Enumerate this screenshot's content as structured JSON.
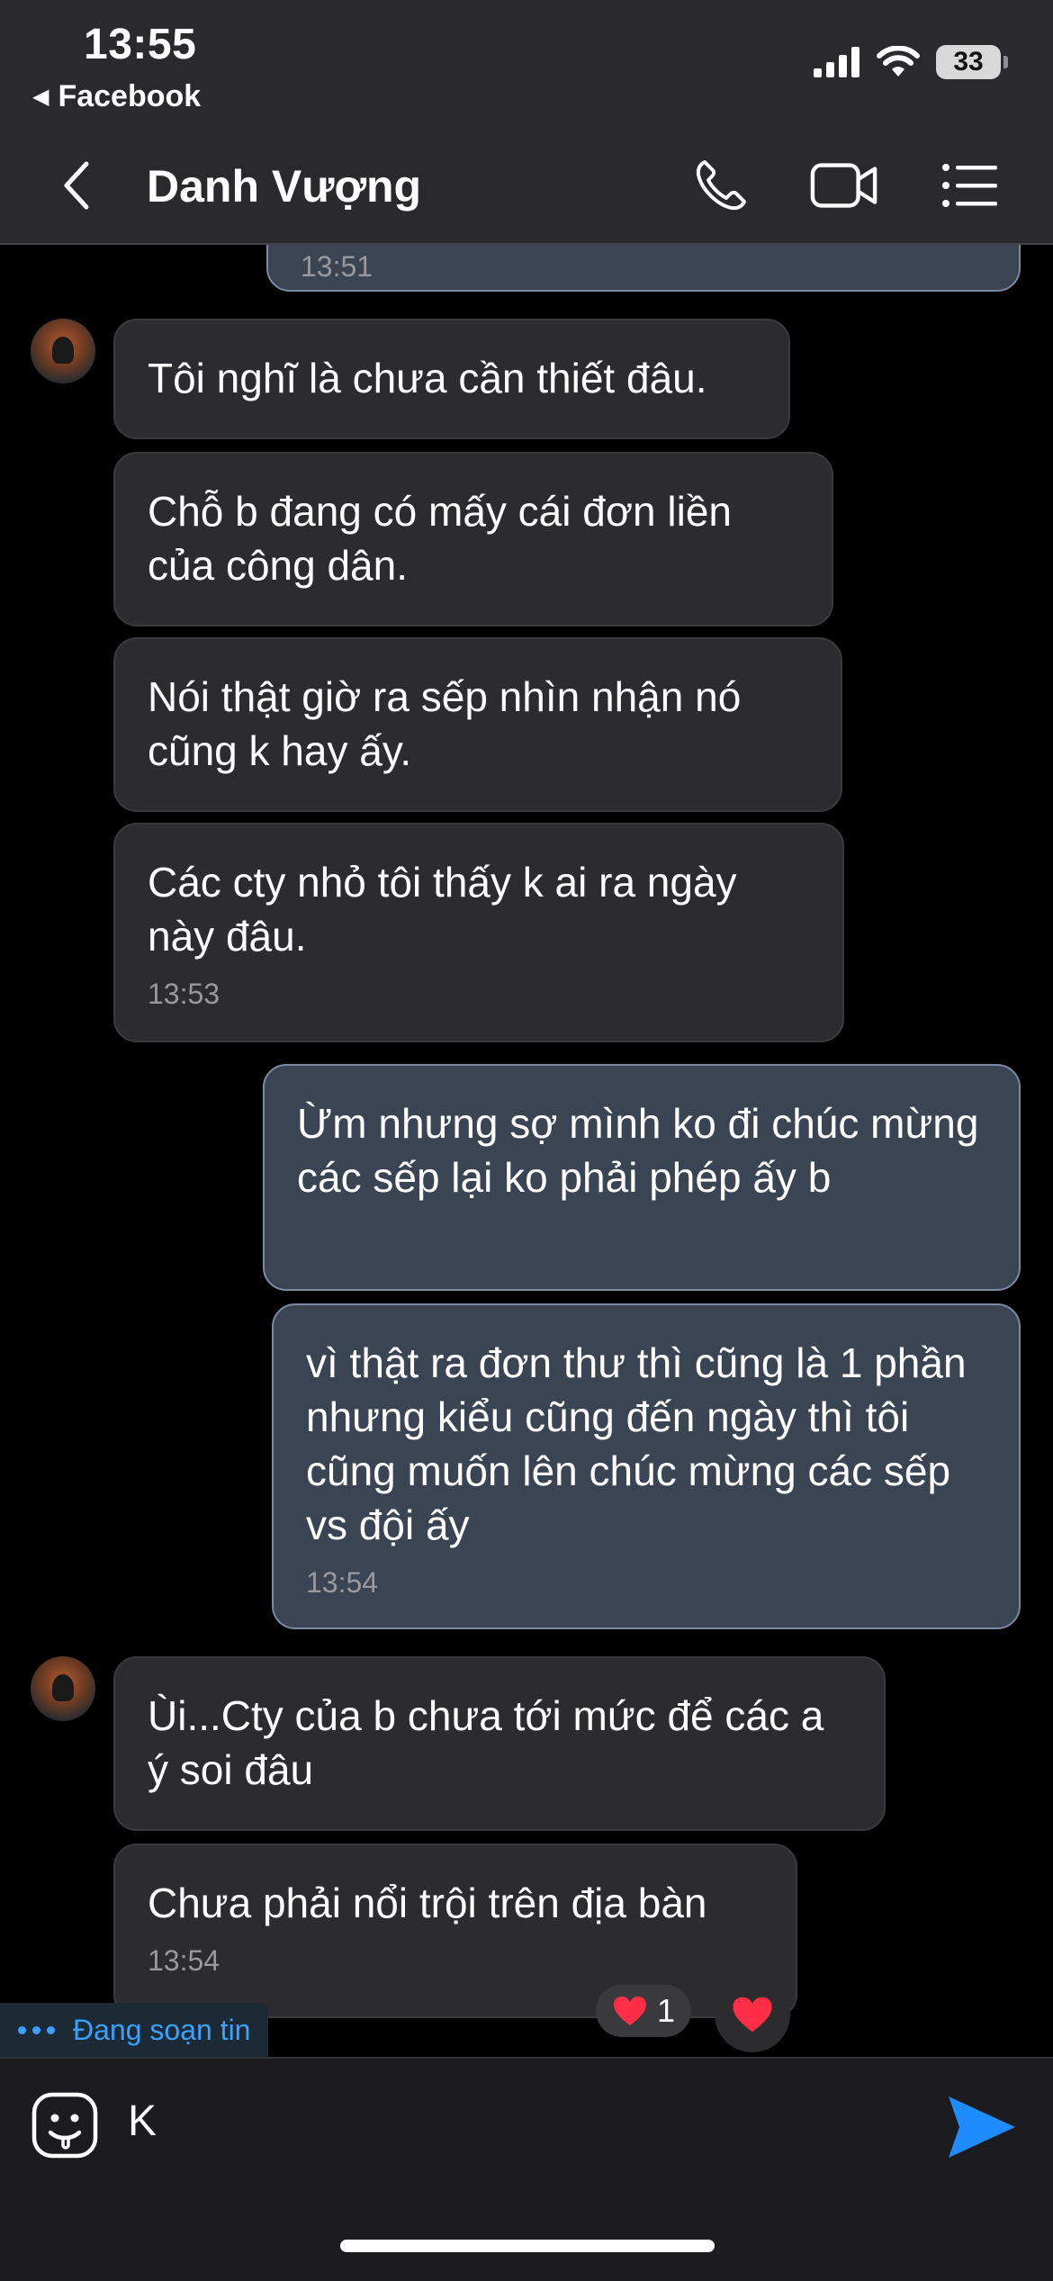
{
  "status_bar": {
    "time": "13:55",
    "back_app": "Facebook",
    "battery": "33"
  },
  "header": {
    "contact_name": "Danh Vượng"
  },
  "messages": {
    "m0": {
      "time": "13:51"
    },
    "m1": {
      "text": "Tôi nghĩ là chưa cần thiết đâu."
    },
    "m2": {
      "text": "Chỗ b đang có mấy cái đơn liền của công dân."
    },
    "m3": {
      "text": "Nói thật giờ ra sếp nhìn nhận nó cũng k hay ấy."
    },
    "m4": {
      "text": "Các cty nhỏ tôi thấy k ai ra ngày này đâu.",
      "time": "13:53"
    },
    "m5": {
      "text": "Ừm nhưng sợ mình ko đi chúc mừng các sếp lại ko phải phép ấy b"
    },
    "m6": {
      "text": "vì thật ra đơn thư thì cũng là 1 phần nhưng kiểu cũng đến ngày thì tôi cũng muốn lên chúc mừng các sếp vs đội ấy",
      "time": "13:54"
    },
    "m7": {
      "text": "Ùi...Cty của b chưa tới mức để các a ý soi đâu"
    },
    "m8": {
      "text": "Chưa phải nổi trội trên địa bàn",
      "time": "13:54"
    }
  },
  "reaction": {
    "emoji": "heart-icon",
    "count": "1"
  },
  "typing_indicator": {
    "label": "Đang soạn tin"
  },
  "composer": {
    "value": "K"
  },
  "colors": {
    "accent": "#1e8bff",
    "heart": "#ff2d46",
    "outgoing_bubble": "#3a4453",
    "incoming_bubble": "#2c2c2e"
  }
}
